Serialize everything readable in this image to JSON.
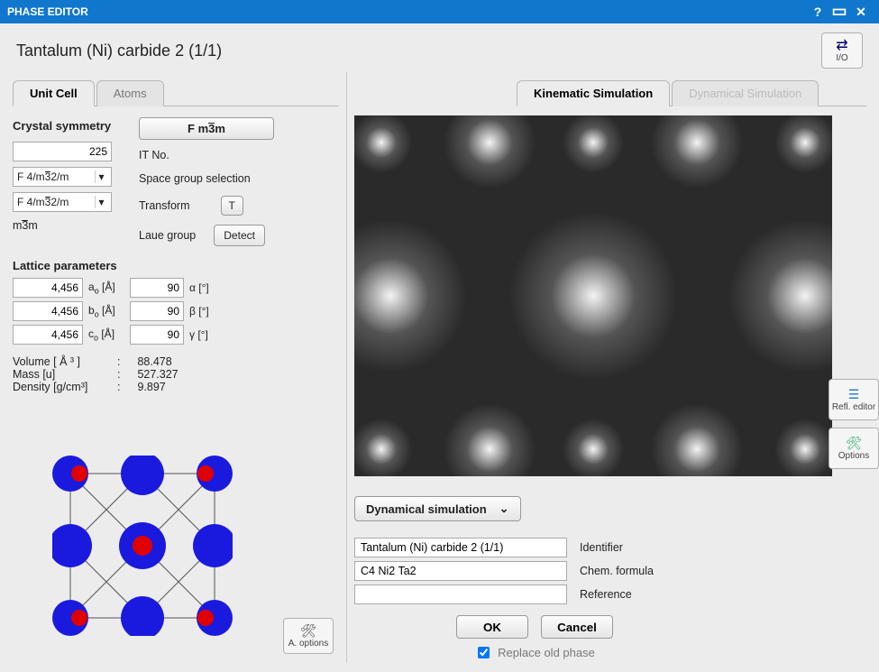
{
  "titlebar": {
    "title": "PHASE EDITOR"
  },
  "header": {
    "title": "Tantalum (Ni) carbide 2 (1/1)",
    "io_label": "I/O"
  },
  "left_tabs": {
    "unit_cell": "Unit Cell",
    "atoms": "Atoms"
  },
  "symmetry": {
    "heading": "Crystal symmetry",
    "space_group_button": "F m3m",
    "it_no_value": "225",
    "it_no_label": "IT No.",
    "sg_sel_value": "F 4/m32/m",
    "sg_sel_label": "Space group selection",
    "transform_value": "F 4/m32/m",
    "transform_label": "Transform",
    "transform_btn": "T",
    "laue_value": "m3m",
    "laue_label": "Laue group",
    "detect_btn": "Detect"
  },
  "lattice": {
    "heading": "Lattice parameters",
    "a": "4,456",
    "a_label": "a",
    "a_unit": "[Å]",
    "b": "4,456",
    "b_label": "b",
    "b_unit": "[Å]",
    "c": "4,456",
    "c_label": "c",
    "c_unit": "[Å]",
    "alpha": "90",
    "alpha_label": "α",
    "alpha_unit": "[°]",
    "beta": "90",
    "beta_label": "β",
    "beta_unit": "[°]",
    "gamma": "90",
    "gamma_label": "γ",
    "gamma_unit": "[°]"
  },
  "stats": {
    "volume_label": "Volume [ Å ³ ]",
    "volume_value": "88.478",
    "mass_label": "Mass [u]",
    "mass_value": "527.327",
    "density_label": "Density [g/cm³]",
    "density_value": "9.897"
  },
  "aoptions_label": "A. options",
  "right_tabs": {
    "kinematic": "Kinematic Simulation",
    "dynamical": "Dynamical Simulation"
  },
  "refl_editor_label": "Refl. editor",
  "options_label": "Options",
  "dyn_select_label": "Dynamical simulation",
  "form": {
    "identifier_value": "Tantalum (Ni) carbide 2 (1/1)",
    "identifier_label": "Identifier",
    "formula_value": "C4 Ni2 Ta2",
    "formula_label": "Chem. formula",
    "reference_value": "",
    "reference_label": "Reference"
  },
  "buttons": {
    "ok": "OK",
    "cancel": "Cancel"
  },
  "replace_label": "Replace old phase"
}
